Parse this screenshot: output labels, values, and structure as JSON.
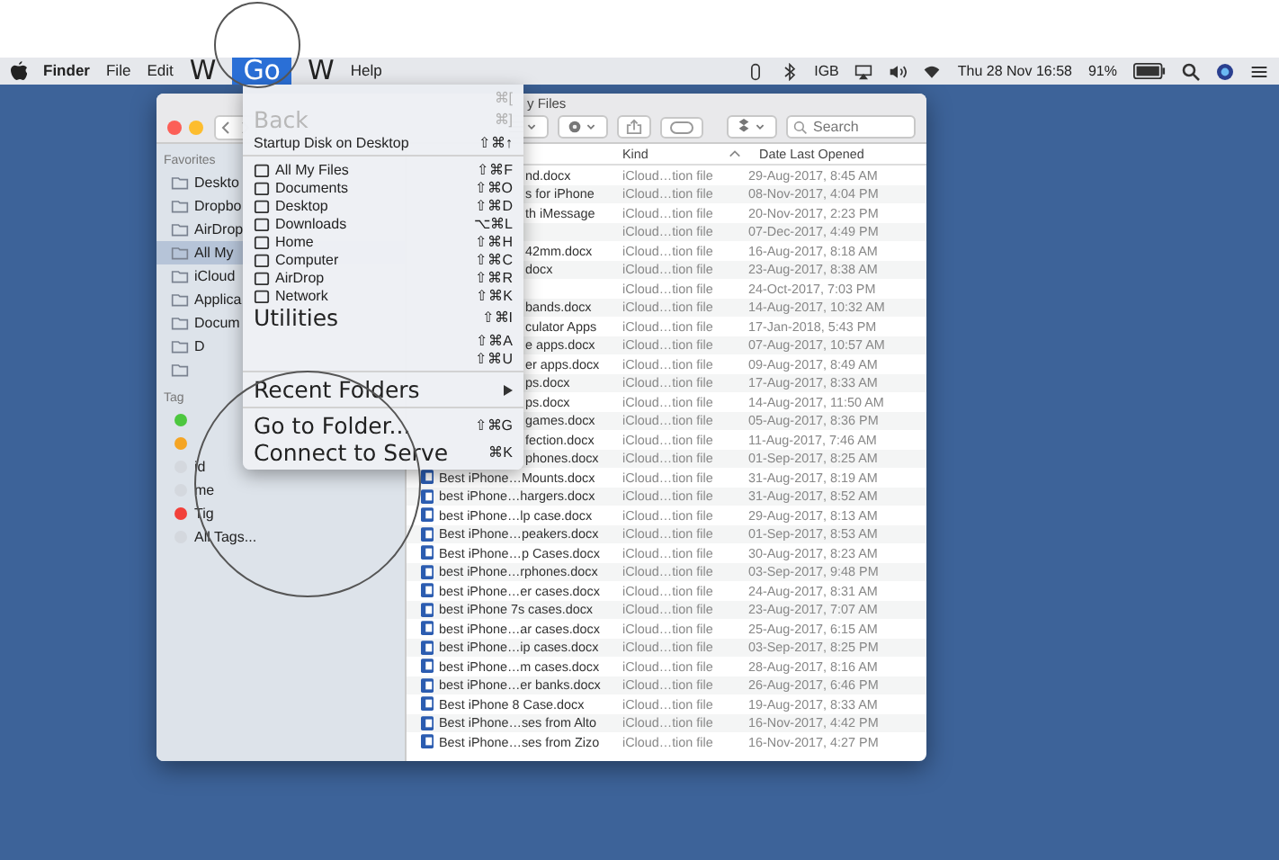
{
  "menu_bar": {
    "items": [
      {
        "label": "Finder",
        "kind": "app",
        "selected": false,
        "zoomed": false
      },
      {
        "label": "File",
        "kind": "menu",
        "selected": false,
        "zoomed": false
      },
      {
        "label": "Edit",
        "kind": "menu",
        "selected": false,
        "zoomed": false
      },
      {
        "label": "W",
        "kind": "menu",
        "selected": false,
        "zoomed": true
      },
      {
        "label": "Go",
        "kind": "menu",
        "selected": true,
        "zoomed": true
      },
      {
        "label": "W",
        "kind": "menu",
        "selected": false,
        "zoomed": true
      },
      {
        "label": "Help",
        "kind": "menu",
        "selected": false,
        "zoomed": false
      }
    ],
    "status": {
      "memory": "IGB",
      "clock": "Thu 28 Nov  16:58",
      "battery": "91%"
    }
  },
  "go_menu": {
    "items": [
      {
        "kind": "item",
        "shortcut": "⌘[",
        "zoomed": false,
        "disabled": true
      },
      {
        "kind": "item",
        "label": "Back",
        "shortcut": "⌘]",
        "zoomed": true,
        "disabled": true
      },
      {
        "kind": "item",
        "label": "Startup Disk on Desktop",
        "shortcut": "⇧⌘↑",
        "zoomed": false,
        "disabled": false
      },
      {
        "kind": "separator"
      },
      {
        "kind": "place",
        "label": "All My Files",
        "shortcut": "⇧⌘F",
        "zoomed": false,
        "disabled": false
      },
      {
        "kind": "place",
        "label": "Documents",
        "shortcut": "⇧⌘O",
        "zoomed": false,
        "disabled": false
      },
      {
        "kind": "place",
        "label": "Desktop",
        "shortcut": "⇧⌘D",
        "zoomed": false,
        "disabled": false
      },
      {
        "kind": "place",
        "label": "Downloads",
        "shortcut": "⌥⌘L",
        "zoomed": false,
        "disabled": false
      },
      {
        "kind": "place",
        "label": "Home",
        "shortcut": "⇧⌘H",
        "zoomed": false,
        "disabled": false
      },
      {
        "kind": "place",
        "label": "Computer",
        "shortcut": "⇧⌘C",
        "zoomed": false,
        "disabled": false
      },
      {
        "kind": "place",
        "label": "AirDrop",
        "shortcut": "⇧⌘R",
        "zoomed": false,
        "disabled": false
      },
      {
        "kind": "place",
        "label": "Network",
        "shortcut": "⇧⌘K",
        "zoomed": false,
        "disabled": false
      },
      {
        "kind": "item",
        "label": "Utilities",
        "shortcut": "⇧⌘I",
        "zoomed": true,
        "disabled": false
      },
      {
        "kind": "item",
        "shortcut": "⇧⌘A",
        "zoomed": false,
        "disabled": false
      },
      {
        "kind": "item",
        "shortcut": "⇧⌘U",
        "zoomed": false,
        "disabled": false
      },
      {
        "kind": "separator"
      },
      {
        "kind": "submenu",
        "label": "Recent Folders",
        "zoomed": true,
        "disabled": false
      },
      {
        "kind": "separator"
      },
      {
        "kind": "item",
        "label": "Go to Folder...",
        "shortcut": "⇧⌘G",
        "zoomed": true,
        "disabled": false
      },
      {
        "kind": "item",
        "label": "Connect to Serve",
        "shortcut": "⌘K",
        "zoomed": true,
        "disabled": false
      }
    ]
  },
  "window": {
    "title": "y Files",
    "search": {
      "placeholder": "Search"
    }
  },
  "sidebar": {
    "favorites_heading": "Favorites",
    "items": [
      {
        "label": "Deskto",
        "selected": false
      },
      {
        "label": "Dropbo",
        "selected": false
      },
      {
        "label": "AirDrop",
        "selected": false
      },
      {
        "label": "All My",
        "selected": true
      },
      {
        "label": "iCloud",
        "selected": false
      },
      {
        "label": "Applica",
        "selected": false
      },
      {
        "label": "Docum",
        "selected": false
      },
      {
        "label": "D",
        "selected": false
      },
      {
        "selected": false
      }
    ],
    "tags_heading": "Tag",
    "tags": [
      {
        "color": "#4cc73f"
      },
      {
        "color": "#f5a524"
      },
      {
        "label": "id",
        "color": "#d4d8de"
      },
      {
        "label": "me",
        "color": "#d4d8de"
      },
      {
        "label": "Tig",
        "color": "#f2403a"
      },
      {
        "label": "All Tags...",
        "color": "#d4d8de"
      }
    ]
  },
  "table": {
    "columns": [
      {
        "label": "Kind",
        "sorted": true
      },
      {
        "label": "Date Last Opened",
        "sorted": false
      }
    ],
    "rows": [
      {
        "kind": "partial",
        "name": "nd.docx",
        "type": "iCloud…tion file",
        "date": "29-Aug-2017, 8:45 AM"
      },
      {
        "kind": "partial",
        "name": "s for iPhone",
        "type": "iCloud…tion file",
        "date": "08-Nov-2017, 4:04 PM"
      },
      {
        "kind": "partial",
        "name": "th iMessage",
        "type": "iCloud…tion file",
        "date": "20-Nov-2017, 2:23 PM"
      },
      {
        "kind": "partial",
        "type": "iCloud…tion file",
        "date": "07-Dec-2017, 4:49 PM"
      },
      {
        "kind": "partial",
        "name": "42mm.docx",
        "type": "iCloud…tion file",
        "date": "16-Aug-2017, 8:18 AM"
      },
      {
        "kind": "partial",
        "name": "docx",
        "type": "iCloud…tion file",
        "date": "23-Aug-2017, 8:38 AM"
      },
      {
        "kind": "partial",
        "type": "iCloud…tion file",
        "date": "24-Oct-2017, 7:03 PM"
      },
      {
        "kind": "partial",
        "name": "bands.docx",
        "type": "iCloud…tion file",
        "date": "14-Aug-2017, 10:32 AM"
      },
      {
        "kind": "partial",
        "name": "culator Apps",
        "type": "iCloud…tion file",
        "date": "17-Jan-2018, 5:43 PM"
      },
      {
        "kind": "partial",
        "name": "e apps.docx",
        "type": "iCloud…tion file",
        "date": "07-Aug-2017, 10:57 AM"
      },
      {
        "kind": "partial",
        "name": "er apps.docx",
        "type": "iCloud…tion file",
        "date": "09-Aug-2017, 8:49 AM"
      },
      {
        "kind": "partial",
        "name": "ps.docx",
        "type": "iCloud…tion file",
        "date": "17-Aug-2017, 8:33 AM"
      },
      {
        "kind": "partial",
        "name": "ps.docx",
        "type": "iCloud…tion file",
        "date": "14-Aug-2017, 11:50 AM"
      },
      {
        "kind": "partial",
        "name": "games.docx",
        "type": "iCloud…tion file",
        "date": "05-Aug-2017, 8:36 PM"
      },
      {
        "kind": "partial",
        "name": "fection.docx",
        "type": "iCloud…tion file",
        "date": "11-Aug-2017, 7:46 AM"
      },
      {
        "kind": "partial",
        "name": "phones.docx",
        "type": "iCloud…tion file",
        "date": "01-Sep-2017, 8:25 AM"
      },
      {
        "kind": "full",
        "name": "Best iPhone…Mounts.docx",
        "type": "iCloud…tion file",
        "date": "31-Aug-2017, 8:19 AM"
      },
      {
        "kind": "full",
        "name": "best iPhone…hargers.docx",
        "type": "iCloud…tion file",
        "date": "31-Aug-2017, 8:52 AM"
      },
      {
        "kind": "full",
        "name": "best iPhone…lp case.docx",
        "type": "iCloud…tion file",
        "date": "29-Aug-2017, 8:13 AM"
      },
      {
        "kind": "full",
        "name": "Best iPhone…peakers.docx",
        "type": "iCloud…tion file",
        "date": "01-Sep-2017, 8:53 AM"
      },
      {
        "kind": "full",
        "name": "Best iPhone…p Cases.docx",
        "type": "iCloud…tion file",
        "date": "30-Aug-2017, 8:23 AM"
      },
      {
        "kind": "full",
        "name": "best iPhone…rphones.docx",
        "type": "iCloud…tion file",
        "date": "03-Sep-2017, 9:48 PM"
      },
      {
        "kind": "full",
        "name": "best iPhone…er cases.docx",
        "type": "iCloud…tion file",
        "date": "24-Aug-2017, 8:31 AM"
      },
      {
        "kind": "full",
        "name": "best iPhone 7s cases.docx",
        "type": "iCloud…tion file",
        "date": "23-Aug-2017, 7:07 AM"
      },
      {
        "kind": "full",
        "name": "best iPhone…ar cases.docx",
        "type": "iCloud…tion file",
        "date": "25-Aug-2017, 6:15 AM"
      },
      {
        "kind": "full",
        "name": "best iPhone…ip cases.docx",
        "type": "iCloud…tion file",
        "date": "03-Sep-2017, 8:25 PM"
      },
      {
        "kind": "full",
        "name": "best iPhone…m cases.docx",
        "type": "iCloud…tion file",
        "date": "28-Aug-2017, 8:16 AM"
      },
      {
        "kind": "full",
        "name": "best iPhone…er banks.docx",
        "type": "iCloud…tion file",
        "date": "26-Aug-2017, 6:46 PM"
      },
      {
        "kind": "full",
        "name": "Best iPhone 8 Case.docx",
        "type": "iCloud…tion file",
        "date": "19-Aug-2017, 8:33 AM"
      },
      {
        "kind": "full",
        "name": "Best iPhone…ses from Alto",
        "type": "iCloud…tion file",
        "date": "16-Nov-2017, 4:42 PM"
      },
      {
        "kind": "full",
        "name": "Best iPhone…ses from Zizo",
        "type": "iCloud…tion file",
        "date": "16-Nov-2017, 4:27 PM"
      }
    ]
  }
}
